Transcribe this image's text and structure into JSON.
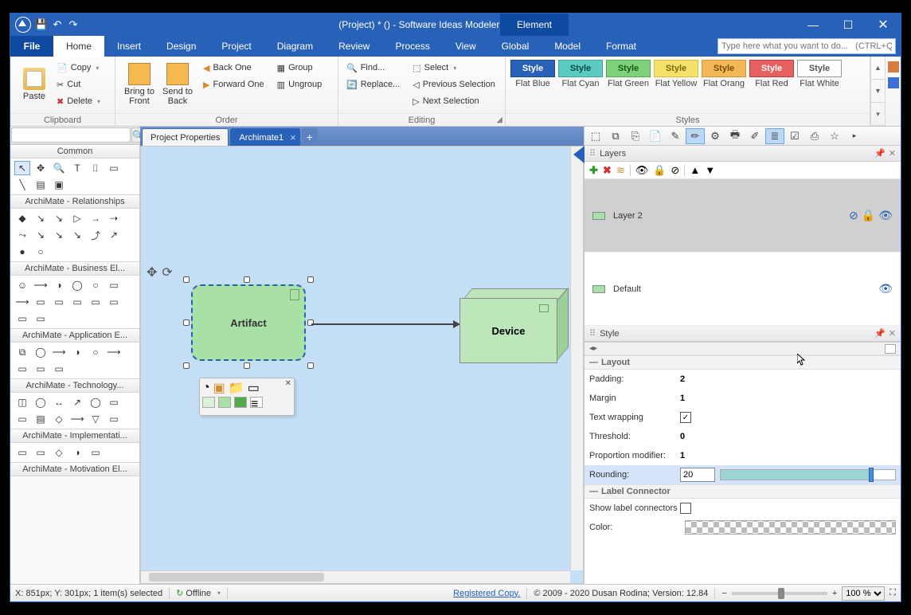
{
  "title": "(Project) * () - Software Ideas Modeler Ultimate",
  "elementTab": "Element",
  "menu": {
    "file": "File",
    "home": "Home",
    "insert": "Insert",
    "design": "Design",
    "project": "Project",
    "diagram": "Diagram",
    "review": "Review",
    "process": "Process",
    "view": "View",
    "global": "Global",
    "model": "Model",
    "format": "Format"
  },
  "searchPlaceholder": "Type here what you want to do...   (CTRL+Q)",
  "ribbon": {
    "paste": "Paste",
    "copy": "Copy",
    "cut": "Cut",
    "delete": "Delete",
    "clipboard": "Clipboard",
    "bringToFront": "Bring to\nFront",
    "sendToBack": "Send to\nBack",
    "backOne": "Back One",
    "forwardOne": "Forward One",
    "group": "Group",
    "ungroup": "Ungroup",
    "order": "Order",
    "find": "Find...",
    "replace": "Replace...",
    "select": "Select",
    "prevSel": "Previous Selection",
    "nextSel": "Next Selection",
    "editing": "Editing",
    "style": "Style",
    "styleNames": [
      "Flat Blue",
      "Flat Cyan",
      "Flat Green",
      "Flat Yellow",
      "Flat Orang",
      "Flat Red",
      "Flat White"
    ],
    "styles": "Styles"
  },
  "tabs": {
    "projProps": "Project Properties",
    "archimate": "Archimate1"
  },
  "left": {
    "common": "Common",
    "rel": "ArchiMate - Relationships",
    "biz": "ArchiMate - Business El...",
    "app": "ArchiMate - Application E...",
    "tech": "ArchiMate - Technology...",
    "impl": "ArchiMate - Implementati...",
    "mot": "ArchiMate - Motivation El..."
  },
  "canvas": {
    "artifact": "Artifact",
    "device": "Device"
  },
  "panels": {
    "layers": "Layers",
    "style": "Style",
    "layer2": "Layer 2",
    "default": "Default"
  },
  "styleProps": {
    "layout": "Layout",
    "padding": "Padding:",
    "paddingV": "2",
    "margin": "Margin",
    "marginV": "1",
    "textwrap": "Text wrapping",
    "threshold": "Threshold:",
    "thresholdV": "0",
    "propmod": "Proportion modifier:",
    "propmodV": "1",
    "rounding": "Rounding:",
    "roundingV": "20",
    "labelConn": "Label Connector",
    "showLbl": "Show label connectors",
    "color": "Color:"
  },
  "status": {
    "coords": "X: 851px; Y: 301px; 1 item(s) selected",
    "offline": "Offline",
    "registered": "Registered Copy.",
    "copyright": "© 2009 - 2020 Dusan Rodina; Version: 12.84",
    "zoom": "100 %"
  }
}
